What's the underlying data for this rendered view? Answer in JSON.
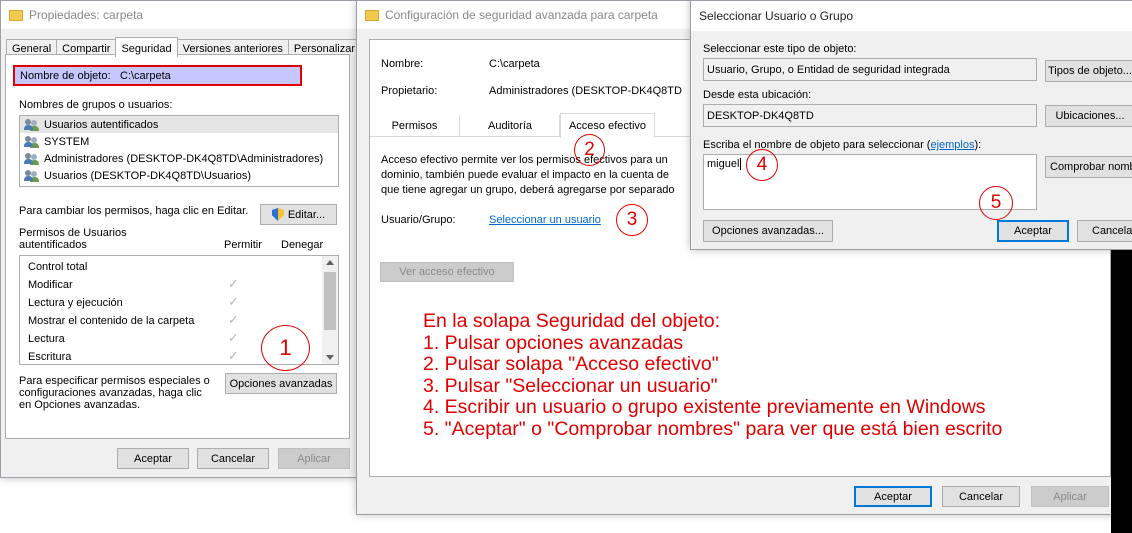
{
  "props_window": {
    "title": "Propiedades: carpeta",
    "tabs": [
      "General",
      "Compartir",
      "Seguridad",
      "Versiones anteriores",
      "Personalizar"
    ],
    "object_name_label": "Nombre de objeto:",
    "object_name_value": "C:\\carpeta",
    "groups_label": "Nombres de grupos o usuarios:",
    "groups": [
      "Usuarios autentificados",
      "SYSTEM",
      "Administradores (DESKTOP-DK4Q8TD\\Administradores)",
      "Usuarios (DESKTOP-DK4Q8TD\\Usuarios)"
    ],
    "change_hint": "Para cambiar los permisos, haga clic en Editar.",
    "edit_button": "Editar...",
    "perms_for_line1": "Permisos de Usuarios",
    "perms_for_line2": "autentificados",
    "allow_header": "Permitir",
    "deny_header": "Denegar",
    "permissions": [
      "Control total",
      "Modificar",
      "Lectura y ejecución",
      "Mostrar el contenido de la carpeta",
      "Lectura",
      "Escritura"
    ],
    "special_hint_1": "Para especificar permisos especiales o",
    "special_hint_2": "configuraciones avanzadas, haga clic",
    "special_hint_3": "en Opciones avanzadas.",
    "advanced_button": "Opciones avanzadas",
    "ok": "Aceptar",
    "cancel": "Cancelar",
    "apply": "Aplicar"
  },
  "adv_window": {
    "title": "Configuración de seguridad avanzada para carpeta",
    "name_label": "Nombre:",
    "name_value": "C:\\carpeta",
    "owner_label": "Propietario:",
    "owner_value": "Administradores (DESKTOP-DK4Q8TD",
    "tabs": [
      "Permisos",
      "Auditoría",
      "Acceso efectivo"
    ],
    "desc_1": "Acceso efectivo permite ver los permisos efectivos para un",
    "desc_2": "dominio, también puede evaluar el impacto en la cuenta de",
    "desc_3": "que tiene agregar un grupo, deberá agregarse por separado",
    "user_group_label": "Usuario/Grupo:",
    "select_user_link": "Seleccionar un usuario",
    "view_effective_button": "Ver acceso efectivo",
    "ok": "Aceptar",
    "cancel": "Cancelar",
    "apply": "Aplicar"
  },
  "select_window": {
    "title": "Seleccionar Usuario o Grupo",
    "object_type_label": "Seleccionar este tipo de objeto:",
    "object_type_value": "Usuario, Grupo, o Entidad de seguridad integrada",
    "object_types_button": "Tipos de objeto...",
    "location_label": "Desde esta ubicación:",
    "location_value": "DESKTOP-DK4Q8TD",
    "locations_button": "Ubicaciones...",
    "enter_label_prefix": "Escriba el nombre de objeto para seleccionar (",
    "enter_label_link": "ejemplos",
    "enter_label_suffix": "):",
    "input_value": "miguel",
    "check_names_button": "Comprobar nombres",
    "advanced_button": "Opciones avanzadas...",
    "ok": "Aceptar",
    "cancel": "Cancelar"
  },
  "annotations": {
    "steps": [
      "1",
      "2",
      "3",
      "4",
      "5"
    ],
    "lines": [
      "En la solapa Seguridad del objeto:",
      "1. Pulsar opciones avanzadas",
      "2. Pulsar solapa \"Acceso efectivo\"",
      "3. Pulsar \"Seleccionar un usuario\"",
      "4. Escribir un usuario o grupo existente previamente en Windows",
      "5. \"Aceptar\" o \"Comprobar nombres\" para ver que está bien escrito"
    ],
    "color": "#e00000"
  },
  "colors": {
    "accent": "#0078d7",
    "highlight": "#c7c7ff",
    "link": "#0066cc"
  }
}
